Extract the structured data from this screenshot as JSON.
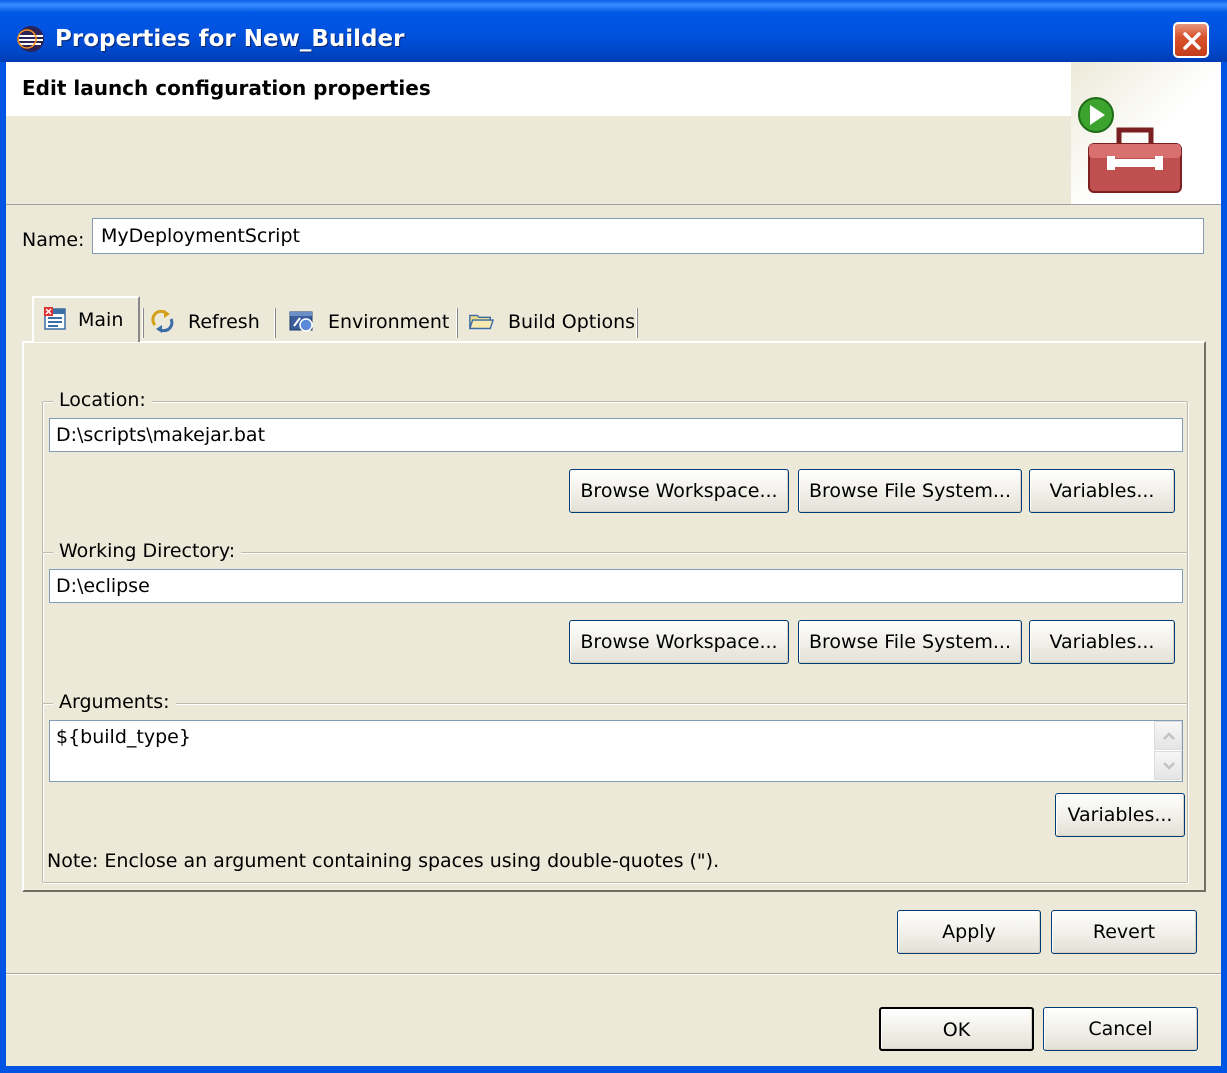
{
  "window": {
    "title": "Properties for New_Builder"
  },
  "banner": {
    "title": "Edit launch configuration properties"
  },
  "name_field": {
    "label": "Name:",
    "value": "MyDeploymentScript"
  },
  "tabs": [
    {
      "label": "Main",
      "icon": "main-tab-icon",
      "active": true
    },
    {
      "label": "Refresh",
      "icon": "refresh-icon",
      "active": false
    },
    {
      "label": "Environment",
      "icon": "environment-icon",
      "active": false
    },
    {
      "label": "Build Options",
      "icon": "folder-icon",
      "active": false
    }
  ],
  "location": {
    "legend": "Location:",
    "value": "D:\\scripts\\makejar.bat",
    "browse_workspace": "Browse Workspace...",
    "browse_file_system": "Browse File System...",
    "variables": "Variables..."
  },
  "working_directory": {
    "legend": "Working Directory:",
    "value": "D:\\eclipse",
    "browse_workspace": "Browse Workspace...",
    "browse_file_system": "Browse File System...",
    "variables": "Variables..."
  },
  "arguments": {
    "legend": "Arguments:",
    "value": "${build_type}",
    "variables": "Variables...",
    "note": "Note: Enclose an argument containing spaces using double-quotes (\")."
  },
  "actions": {
    "apply": "Apply",
    "revert": "Revert",
    "ok": "OK",
    "cancel": "Cancel"
  },
  "colors": {
    "title_bar": "#0054E3",
    "dialog_background": "#ECE9D8",
    "close_button": "#D9532C"
  }
}
